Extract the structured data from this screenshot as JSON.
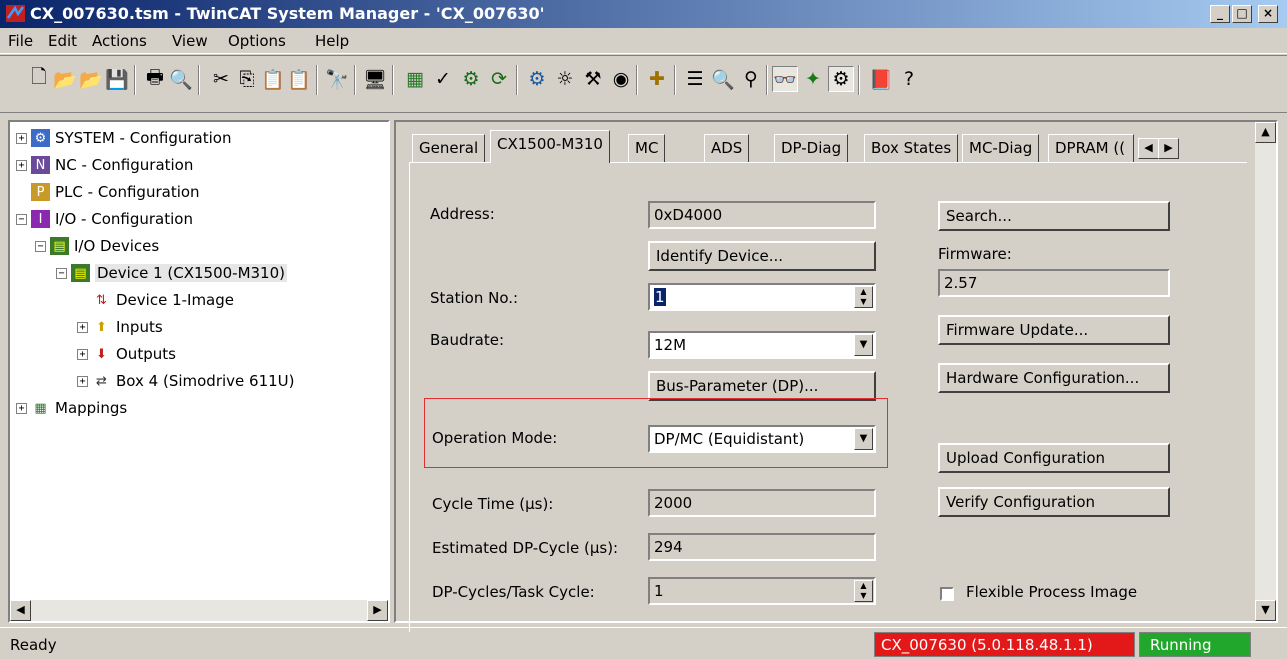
{
  "window": {
    "title": "CX_007630.tsm - TwinCAT System Manager - 'CX_007630'",
    "controls": [
      "_",
      "□",
      "×"
    ]
  },
  "menu": [
    "File",
    "Edit",
    "Actions",
    "View",
    "Options",
    "Help"
  ],
  "toolbar": {
    "icons": [
      "new-icon",
      "open-icon",
      "open-folder-icon",
      "save-icon",
      "print-icon",
      "print-preview-icon",
      "cut-icon",
      "copy-icon",
      "paste-icon",
      "paste-special-icon",
      "find-icon",
      "monitor-icon",
      "generate-mappings-icon",
      "check-icon",
      "activate-icon",
      "restart-icon",
      "config-mode-icon",
      "scan-icon",
      "tools-icon",
      "online-icon",
      "add-icon",
      "list-icon",
      "zoom-icon",
      "network-icon",
      "glasses-icon",
      "plc-icon",
      "debug-icon",
      "book-icon",
      "help-icon"
    ]
  },
  "tree": {
    "items": [
      {
        "label": "SYSTEM - Configuration",
        "expander": "+",
        "icon": "system-config-icon"
      },
      {
        "label": "NC - Configuration",
        "expander": "+",
        "icon": "nc-config-icon"
      },
      {
        "label": "PLC - Configuration",
        "expander": "",
        "icon": "plc-config-icon"
      },
      {
        "label": "I/O - Configuration",
        "expander": "−",
        "icon": "io-config-icon"
      },
      {
        "label": "I/O Devices",
        "expander": "−",
        "icon": "io-devices-icon"
      },
      {
        "label": "Device 1 (CX1500-M310)",
        "expander": "−",
        "icon": "device-icon"
      },
      {
        "label": "Device 1-Image",
        "expander": "",
        "icon": "image-icon"
      },
      {
        "label": "Inputs",
        "expander": "+",
        "icon": "inputs-icon"
      },
      {
        "label": "Outputs",
        "expander": "+",
        "icon": "outputs-icon"
      },
      {
        "label": "Box 4 (Simodrive 611U)",
        "expander": "+",
        "icon": "box-icon"
      },
      {
        "label": "Mappings",
        "expander": "+",
        "icon": "mappings-icon"
      }
    ]
  },
  "tabs": [
    "General",
    "CX1500-M310",
    "MC",
    "ADS",
    "DP-Diag",
    "Box States",
    "MC-Diag",
    "DPRAM (("
  ],
  "active_tab": "CX1500-M310",
  "form": {
    "address_label": "Address:",
    "address_value": "0xD4000",
    "identify_button": "Identify Device...",
    "station_label": "Station No.:",
    "station_value": "1",
    "baudrate_label": "Baudrate:",
    "baudrate_value": "12M",
    "bus_param_button": "Bus-Parameter (DP)...",
    "opmode_label": "Operation Mode:",
    "opmode_value": "DP/MC (Equidistant)",
    "cycle_label": "Cycle Time (µs):",
    "cycle_value": "2000",
    "est_label": "Estimated DP-Cycle (µs):",
    "est_value": "294",
    "dpcycles_label": "DP-Cycles/Task Cycle:",
    "dpcycles_value": "1",
    "search_button": "Search...",
    "firmware_label": "Firmware:",
    "firmware_value": "2.57",
    "fw_update_button": "Firmware Update...",
    "hw_config_button": "Hardware Configuration...",
    "upload_button": "Upload Configuration",
    "verify_button": "Verify Configuration",
    "flexible_label": "Flexible Process Image",
    "flexible_checked": false
  },
  "status": {
    "ready": "Ready",
    "target": "CX_007630 (5.0.118.48.1.1)",
    "state": "Running",
    "target_color": "#e31919",
    "state_color": "#21a82c"
  }
}
